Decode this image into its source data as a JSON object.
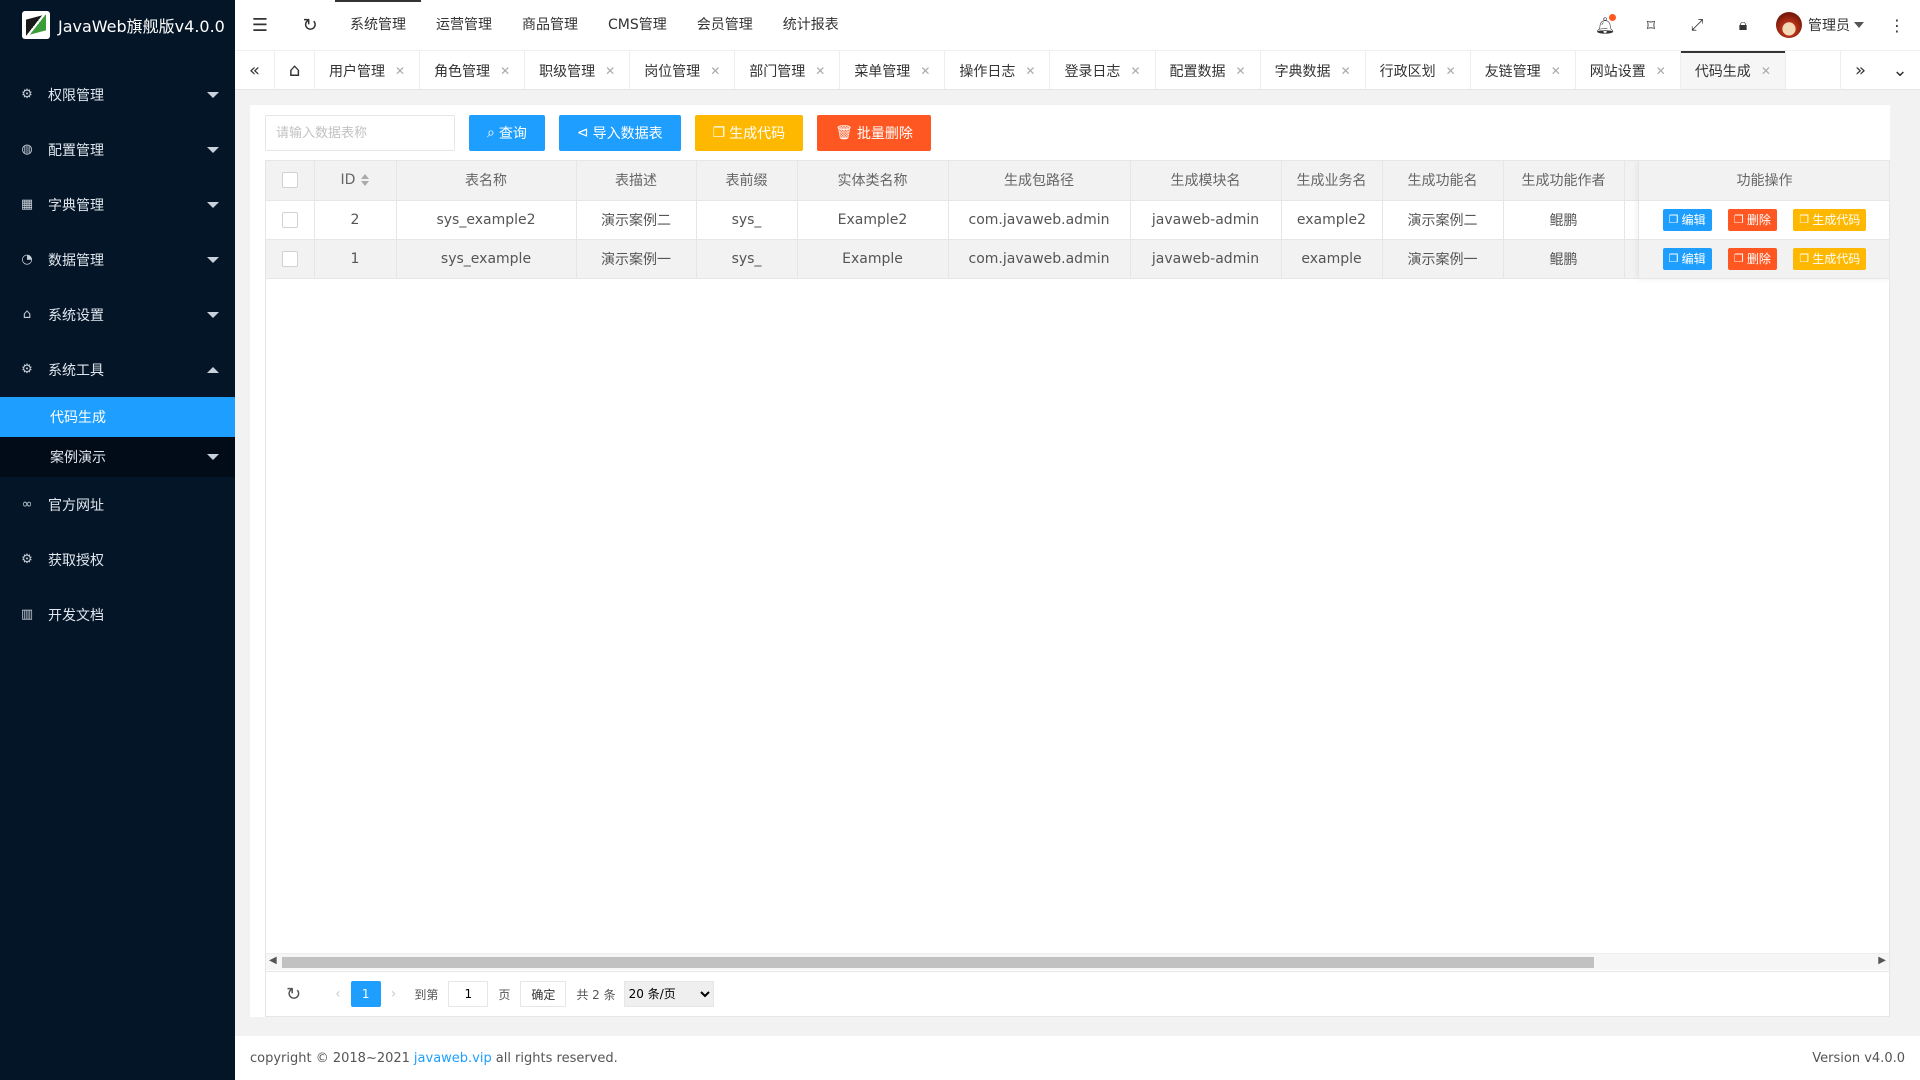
{
  "app": {
    "title": "JavaWeb旗舰版v4.0.0"
  },
  "sidebar": {
    "items": [
      {
        "label": "权限管理",
        "icon": "lock-icon"
      },
      {
        "label": "配置管理",
        "icon": "globe-icon"
      },
      {
        "label": "字典管理",
        "icon": "grid-icon"
      },
      {
        "label": "数据管理",
        "icon": "dashboard-icon"
      },
      {
        "label": "系统设置",
        "icon": "home-icon"
      },
      {
        "label": "系统工具",
        "icon": "gear-icon"
      },
      {
        "label": "官方网址",
        "icon": "link-icon"
      },
      {
        "label": "获取授权",
        "icon": "gear-icon"
      },
      {
        "label": "开发文档",
        "icon": "book-icon"
      }
    ],
    "sub": [
      {
        "label": "代码生成"
      },
      {
        "label": "案例演示"
      }
    ]
  },
  "header": {
    "nav": [
      "系统管理",
      "运营管理",
      "商品管理",
      "CMS管理",
      "会员管理",
      "统计报表"
    ],
    "user": "管理员"
  },
  "tabs": [
    "用户管理",
    "角色管理",
    "职级管理",
    "岗位管理",
    "部门管理",
    "菜单管理",
    "操作日志",
    "登录日志",
    "配置数据",
    "字典数据",
    "行政区划",
    "友链管理",
    "网站设置",
    "代码生成"
  ],
  "toolbar": {
    "search_placeholder": "请输入数据表称",
    "query": "查询",
    "import": "导入数据表",
    "generate": "生成代码",
    "batch_delete": "批量删除"
  },
  "table": {
    "headers": [
      "ID",
      "表名称",
      "表描述",
      "表前缀",
      "实体类名称",
      "生成包路径",
      "生成模块名",
      "生成业务名",
      "生成功能名",
      "生成功能作者",
      "功能操作"
    ],
    "rows": [
      [
        "2",
        "sys_example2",
        "演示案例二",
        "sys_",
        "Example2",
        "com.javaweb.admin",
        "javaweb-admin",
        "example2",
        "演示案例二",
        "鲲鹏"
      ],
      [
        "1",
        "sys_example",
        "演示案例一",
        "sys_",
        "Example",
        "com.javaweb.admin",
        "javaweb-admin",
        "example",
        "演示案例一",
        "鲲鹏"
      ]
    ],
    "actions": {
      "edit": "编辑",
      "delete": "删除",
      "generate": "生成代码"
    }
  },
  "pager": {
    "current": "1",
    "goto_label": "到第",
    "goto_value": "1",
    "page_label": "页",
    "confirm": "确定",
    "total": "共 2 条",
    "page_size": "20 条/页"
  },
  "footer": {
    "copyright_prefix": "copyright © 2018~2021",
    "link": "javaweb.vip",
    "copyright_suffix": "all rights reserved.",
    "version": "Version v4.0.0"
  },
  "colors": {
    "sidebar": "#041527",
    "primary": "#1e9fff",
    "warning": "#ffb800",
    "danger": "#ff5722"
  }
}
